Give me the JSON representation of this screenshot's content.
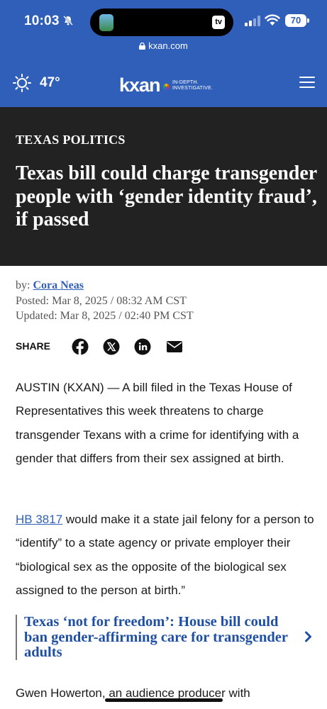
{
  "status_bar": {
    "time": "10:03",
    "battery": "70",
    "live_activity": "tv"
  },
  "browser": {
    "url": "kxan.com"
  },
  "site_header": {
    "temperature": "47°",
    "logo": "kxan",
    "tagline_line1": "IN-DEPTH.",
    "tagline_line2": "INVESTIGATIVE."
  },
  "article": {
    "section": "TEXAS POLITICS",
    "headline": "Texas bill could charge transgender people with ‘gender identity fraud’, if passed",
    "byline_prefix": "by:",
    "author": "Cora Neas",
    "posted": "Posted: Mar 8, 2025 / 08:32 AM CST",
    "updated": "Updated: Mar 8, 2025 / 02:40 PM CST",
    "share_label": "SHARE",
    "share_icons": [
      "facebook-icon",
      "x-icon",
      "linkedin-icon",
      "email-icon"
    ],
    "paragraph1": "AUSTIN (KXAN) — A bill filed in the Texas House of Representatives this week threatens to charge transgender Texans with a crime for identifying with a gender that differs from their sex assigned at birth.",
    "paragraph2_link": "HB 3817",
    "paragraph2_rest": " would make it a state jail felony for a person to “identify” to a state agency or private employer their “biological sex as the opposite of the biological sex assigned to the person at birth.”",
    "related_title": "Texas ‘not for freedom’: House bill could ban gender-affirming care for transgender adults",
    "paragraph3_start": "Gwen Howerton, an audience producer with"
  },
  "colors": {
    "header_blue": "#2f5fb8",
    "headline_band": "#222222",
    "link_blue": "#2f5fb8",
    "related_blue": "#1e4fa3"
  }
}
